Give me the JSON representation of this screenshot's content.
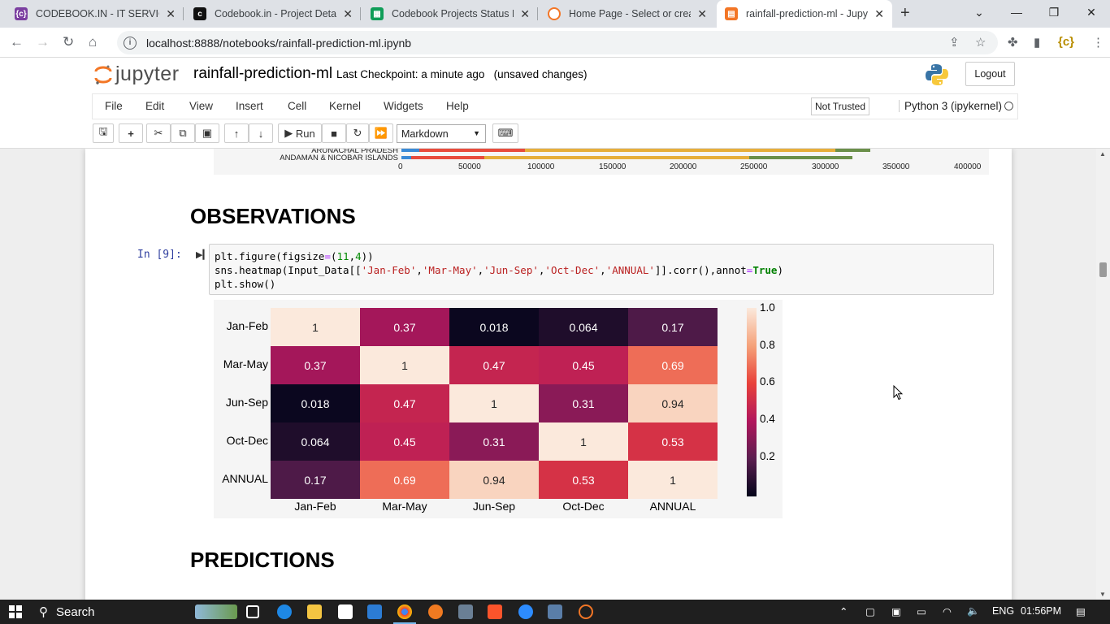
{
  "browser": {
    "tabs": [
      {
        "title": "CODEBOOK.IN - IT SERVICES",
        "icon": "codebook-icon",
        "color": "#7b3fa0"
      },
      {
        "title": "Codebook.in - Project Details",
        "icon": "codebook-dark-icon",
        "color": "#111111"
      },
      {
        "title": "Codebook Projects Status Re",
        "icon": "sheets-icon",
        "color": "#0f9d58"
      },
      {
        "title": "Home Page - Select or create",
        "icon": "jupyter-icon",
        "color": "#f37626"
      },
      {
        "title": "rainfall-prediction-ml - Jupyt",
        "icon": "notebook-icon",
        "color": "#f37626"
      }
    ],
    "url": "localhost:8888/notebooks/rainfall-prediction-ml.ipynb"
  },
  "jupyter": {
    "logo_text": "jupyter",
    "notebook_name": "rainfall-prediction-ml",
    "checkpoint": "Last Checkpoint: a minute ago",
    "unsaved": "(unsaved changes)",
    "logout": "Logout",
    "menus": [
      "File",
      "Edit",
      "View",
      "Insert",
      "Cell",
      "Kernel",
      "Widgets",
      "Help"
    ],
    "trusted": "Not Trusted",
    "kernel": "Python 3 (ipykernel)",
    "run_label": "Run",
    "cell_type": "Markdown"
  },
  "prev_output": {
    "labels": [
      "ARUNACHAL PRADESH",
      "ANDAMAN & NICOBAR ISLANDS"
    ],
    "xticks": [
      "0",
      "50000",
      "100000",
      "150000",
      "200000",
      "250000",
      "300000",
      "350000",
      "400000"
    ]
  },
  "notebook": {
    "heading1": "OBSERVATIONS",
    "prompt": "In [9]:",
    "code_lines": [
      "plt.figure(figsize=(11,4))",
      "sns.heatmap(Input_Data[['Jan-Feb','Mar-May','Jun-Sep','Oct-Dec','ANNUAL']].corr(),annot=True)",
      "plt.show()"
    ],
    "heading2": "PREDICTIONS"
  },
  "chart_data": {
    "type": "heatmap",
    "rows": [
      "Jan-Feb",
      "Mar-May",
      "Jun-Sep",
      "Oct-Dec",
      "ANNUAL"
    ],
    "cols": [
      "Jan-Feb",
      "Mar-May",
      "Jun-Sep",
      "Oct-Dec",
      "ANNUAL"
    ],
    "values": [
      [
        "1",
        "0.37",
        "0.018",
        "0.064",
        "0.17"
      ],
      [
        "0.37",
        "1",
        "0.47",
        "0.45",
        "0.69"
      ],
      [
        "0.018",
        "0.47",
        "1",
        "0.31",
        "0.94"
      ],
      [
        "0.064",
        "0.45",
        "0.31",
        "1",
        "0.53"
      ],
      [
        "0.17",
        "0.69",
        "0.94",
        "0.53",
        "1"
      ]
    ],
    "colorbar_ticks": [
      "1.0",
      "0.8",
      "0.6",
      "0.4",
      "0.2"
    ],
    "colorbar_range": [
      0.0,
      1.0
    ]
  },
  "taskbar": {
    "search": "Search",
    "lang": "ENG",
    "time": "01:56PM"
  }
}
